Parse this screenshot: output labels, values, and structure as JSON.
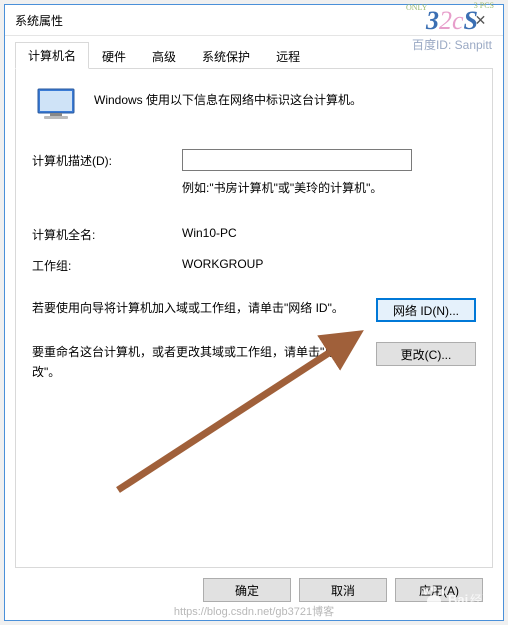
{
  "window": {
    "title": "系统属性",
    "close_glyph": "✕"
  },
  "tabs": {
    "computer_name": "计算机名",
    "hardware": "硬件",
    "advanced": "高级",
    "system_protection": "系统保护",
    "remote": "远程"
  },
  "panel": {
    "intro": "Windows 使用以下信息在网络中标识这台计算机。",
    "desc_label": "计算机描述(D):",
    "desc_value": "",
    "desc_placeholder": "",
    "example": "例如:\"书房计算机\"或\"美玲的计算机\"。",
    "full_name_label": "计算机全名:",
    "full_name_value": "Win10-PC",
    "workgroup_label": "工作组:",
    "workgroup_value": "WORKGROUP",
    "network_id_text": "若要使用向导将计算机加入域或工作组，请单击\"网络 ID\"。",
    "network_id_button": "网络 ID(N)...",
    "change_text": "要重命名这台计算机，或者更改其域或工作组，请单击\"更改\"。",
    "change_button": "更改(C)..."
  },
  "buttons": {
    "ok": "确定",
    "cancel": "取消",
    "apply": "应用(A)"
  },
  "watermark": {
    "top_small1": "ONLY",
    "top_small2": "3 PCS",
    "top_logo_a": "3",
    "top_logo_b": "2c",
    "top_logo_c": "S",
    "top_id": "百度ID: Sanpitt",
    "bottom": "https://blog.csdn.net/gb3721博客",
    "baidu_text": "Bai",
    "baidu_text2": "经验"
  }
}
